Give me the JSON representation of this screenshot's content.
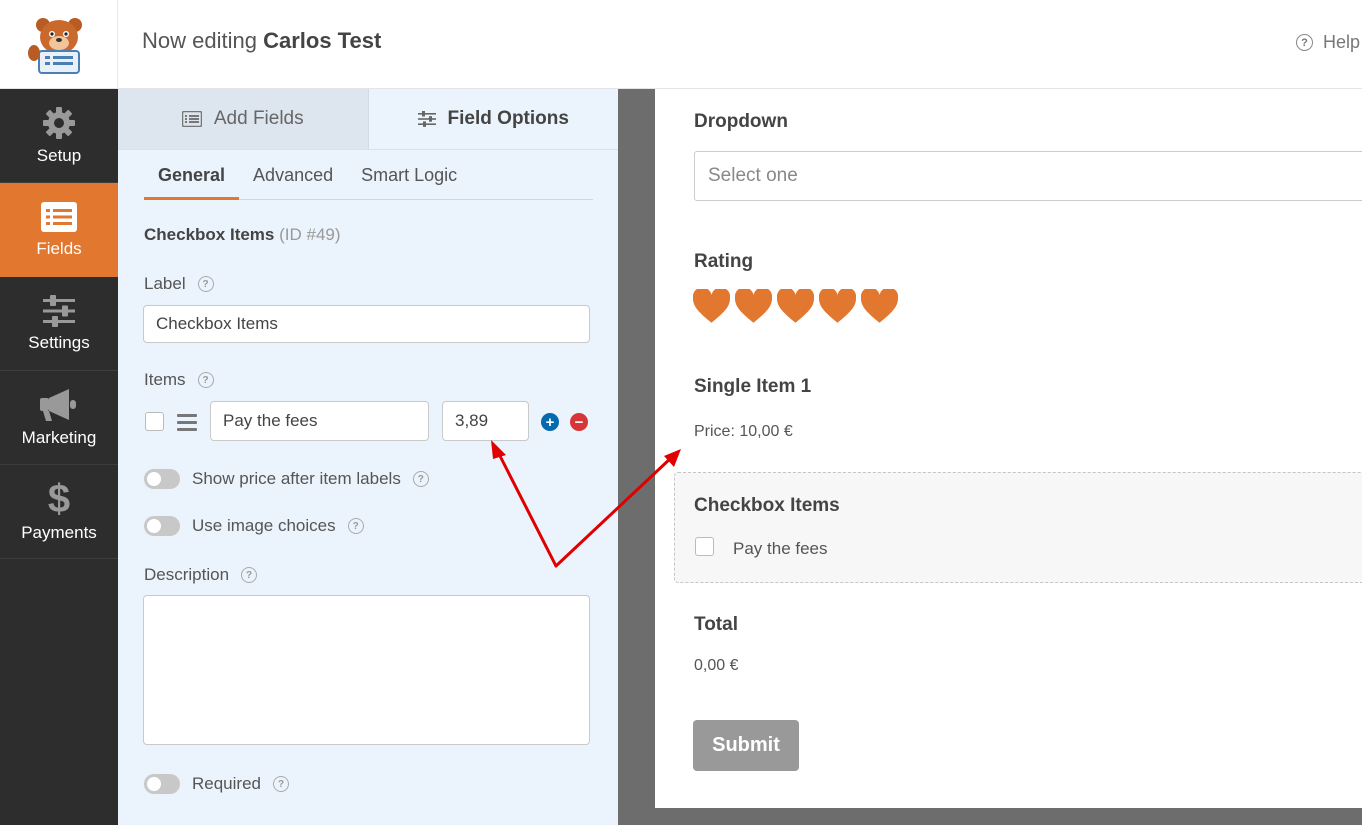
{
  "header": {
    "prefix": "Now editing",
    "form_name": "Carlos Test",
    "help_label": "Help"
  },
  "sidebar": {
    "items": [
      {
        "label": "Setup",
        "icon": "gear-icon"
      },
      {
        "label": "Fields",
        "icon": "list-icon",
        "active": true
      },
      {
        "label": "Settings",
        "icon": "sliders-icon"
      },
      {
        "label": "Marketing",
        "icon": "megaphone-icon"
      },
      {
        "label": "Payments",
        "icon": "dollar-icon"
      }
    ]
  },
  "panel": {
    "tabs": {
      "add_fields": "Add Fields",
      "field_options": "Field Options"
    },
    "sub_tabs": {
      "general": "General",
      "advanced": "Advanced",
      "smart_logic": "Smart Logic"
    },
    "field_title": "Checkbox Items",
    "field_id": "(ID #49)",
    "label_caption": "Label",
    "label_value": "Checkbox Items",
    "items_caption": "Items",
    "item": {
      "label": "Pay the fees",
      "price": "3,89"
    },
    "show_price_label": "Show price after item labels",
    "image_choices_label": "Use image choices",
    "description_caption": "Description",
    "description_value": "",
    "required_label": "Required"
  },
  "preview": {
    "dropdown_label": "Dropdown",
    "dropdown_placeholder": "Select one",
    "rating_label": "Rating",
    "rating_value": 5,
    "single_item_label": "Single Item 1",
    "single_item_price": "Price: 10,00 €",
    "checkbox_label": "Checkbox Items",
    "checkbox_option": "Pay the fees",
    "total_label": "Total",
    "total_value": "0,00 €",
    "submit_label": "Submit"
  },
  "colors": {
    "accent": "#e27730",
    "sidebar": "#2d2d2d",
    "panel": "#ebf3fc",
    "arrow": "#e00000",
    "add_button": "#036aab",
    "remove_button": "#d63638"
  }
}
